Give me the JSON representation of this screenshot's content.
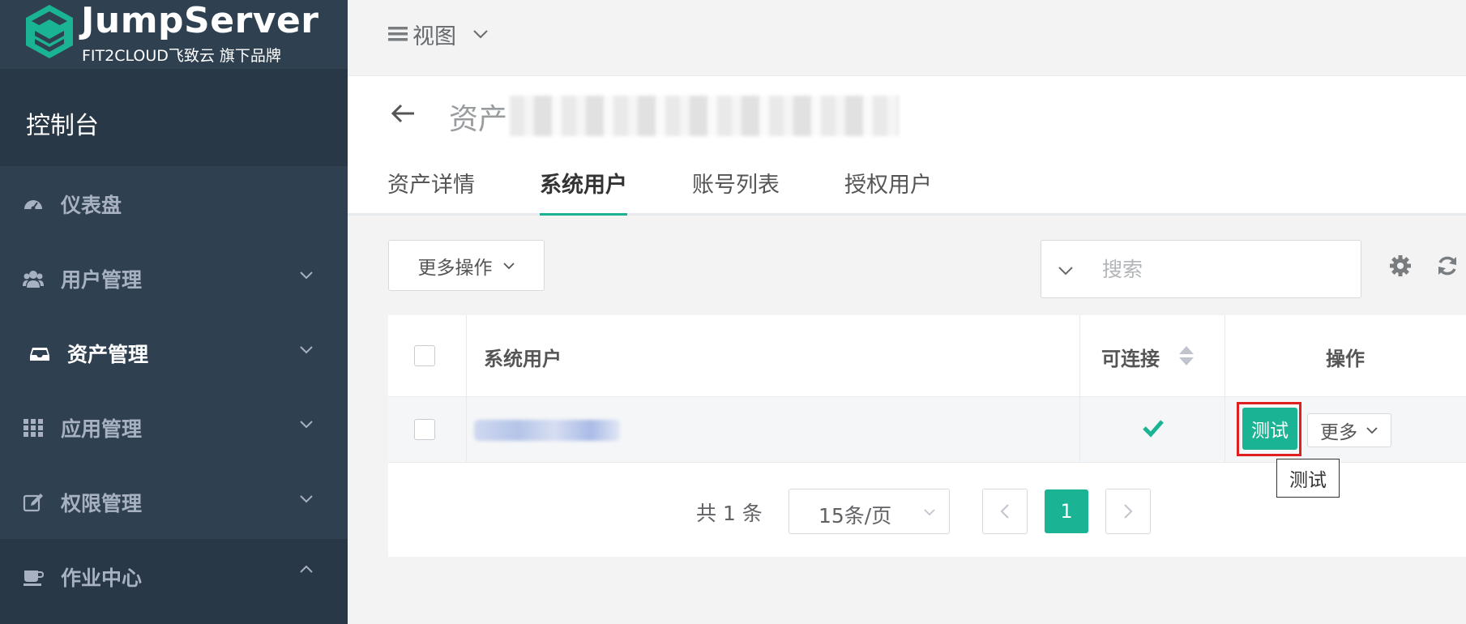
{
  "brand": {
    "title": "JumpServer",
    "subtitle": "FIT2CLOUD飞致云 旗下品牌",
    "accent": "#1ab394",
    "sidebar_bg": "#2f4050"
  },
  "sidebar": {
    "console_label": "控制台",
    "items": [
      {
        "label": "仪表盘",
        "icon": "dashboard-icon",
        "expandable": false
      },
      {
        "label": "用户管理",
        "icon": "users-icon",
        "expandable": true
      },
      {
        "label": "资产管理",
        "icon": "inbox-icon",
        "expandable": true,
        "active": true
      },
      {
        "label": "应用管理",
        "icon": "grid-icon",
        "expandable": true
      },
      {
        "label": "权限管理",
        "icon": "edit-icon",
        "expandable": true
      },
      {
        "label": "作业中心",
        "icon": "coffee-icon",
        "expandable": true,
        "expanded": true
      }
    ]
  },
  "topbar": {
    "view_label": "视图"
  },
  "page": {
    "title": "资产",
    "tabs": [
      {
        "label": "资产详情",
        "active": false
      },
      {
        "label": "系统用户",
        "active": true
      },
      {
        "label": "账号列表",
        "active": false
      },
      {
        "label": "授权用户",
        "active": false
      }
    ]
  },
  "toolbar": {
    "more_actions_label": "更多操作",
    "search_placeholder": "搜索"
  },
  "table": {
    "columns": [
      "系统用户",
      "可连接",
      "操作"
    ],
    "rows": [
      {
        "connectable": true,
        "test_label": "测试",
        "more_label": "更多"
      }
    ]
  },
  "tooltip": {
    "text": "测试"
  },
  "pagination": {
    "total_text": "共 1 条",
    "page_size_label": "15条/页",
    "current_page": "1"
  }
}
